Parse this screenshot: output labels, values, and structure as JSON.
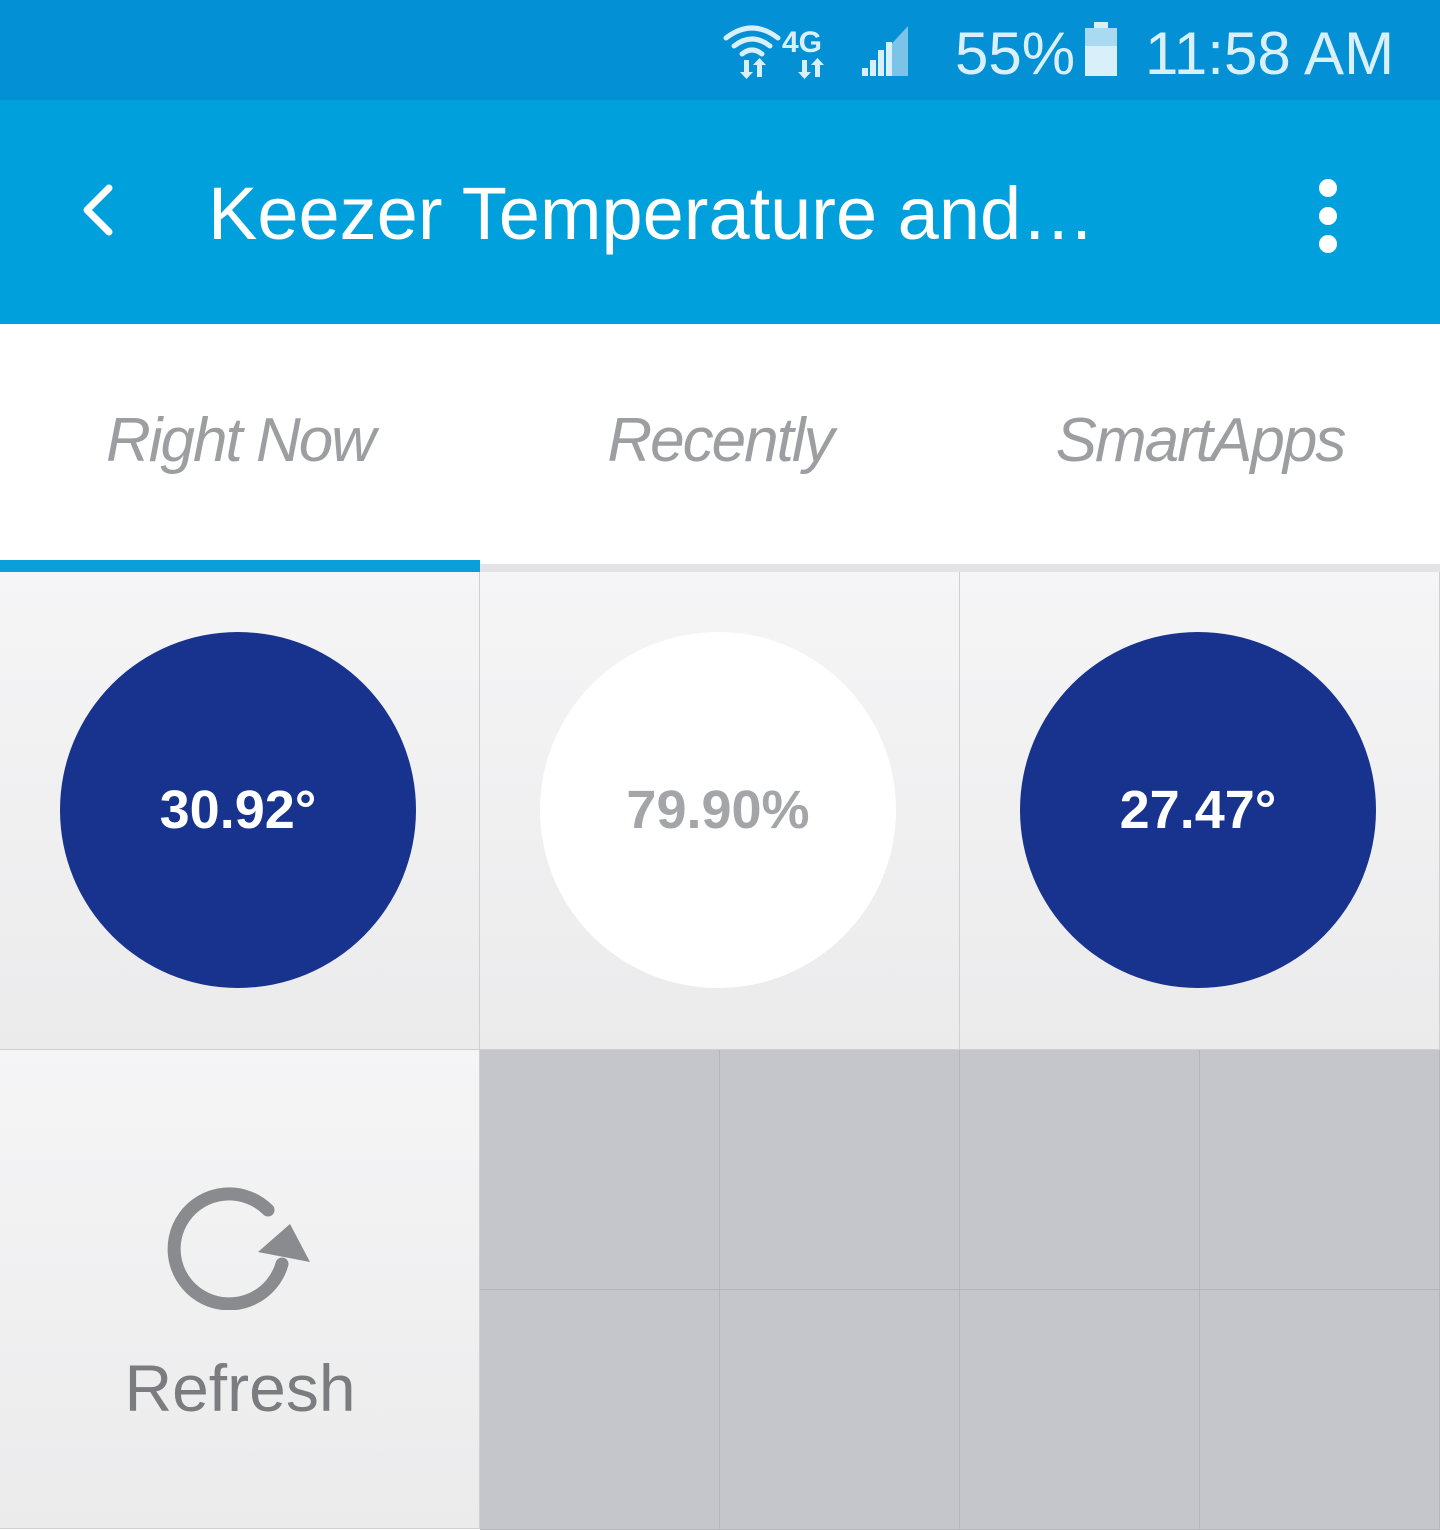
{
  "status_bar": {
    "network_label": "4G",
    "battery_percent": "55%",
    "time": "11:58 AM",
    "icons": [
      "wifi-icon",
      "lte-icon",
      "signal-icon",
      "battery-icon"
    ]
  },
  "app_bar": {
    "title": "Keezer Temperature and…",
    "back_icon": "chevron-left-icon",
    "menu_icon": "more-vertical-icon"
  },
  "tabs": [
    {
      "label": "Right Now",
      "active": true
    },
    {
      "label": "Recently",
      "active": false
    },
    {
      "label": "SmartApps",
      "active": false
    }
  ],
  "tiles": [
    {
      "value": "30.92°",
      "style": "dark"
    },
    {
      "value": "79.90%",
      "style": "light"
    },
    {
      "value": "27.47°",
      "style": "dark"
    }
  ],
  "refresh": {
    "label": "Refresh",
    "icon": "refresh-icon"
  },
  "colors": {
    "status_bar": "#0490d4",
    "app_bar": "#00a0dc",
    "tab_indicator": "#0a9fd9",
    "tile_dark": "#18338e",
    "empty_grid": "#c5c6cb"
  }
}
